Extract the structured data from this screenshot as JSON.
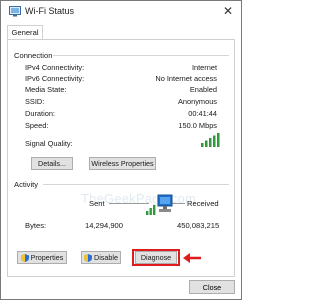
{
  "window": {
    "title": "Wi-Fi Status",
    "close_glyph": "✕"
  },
  "tabs": [
    {
      "label": "General"
    }
  ],
  "connection": {
    "title": "Connection",
    "rows": [
      {
        "label": "IPv4 Connectivity:",
        "value": "Internet"
      },
      {
        "label": "IPv6 Connectivity:",
        "value": "No Internet access"
      },
      {
        "label": "Media State:",
        "value": "Enabled"
      },
      {
        "label": "SSID:",
        "value": "Anonymous"
      },
      {
        "label": "Duration:",
        "value": "00:41:44"
      },
      {
        "label": "Speed:",
        "value": "150.0 Mbps"
      }
    ],
    "signal_label": "Signal Quality:",
    "signal_bars": 5,
    "details_label": "Details...",
    "wireless_label": "Wireless Properties"
  },
  "watermark": "TheGeekPage.com",
  "activity": {
    "title": "Activity",
    "sent_label": "Sent",
    "received_label": "Received",
    "bytes_label": "Bytes:",
    "bytes_sent": "14,294,900",
    "bytes_received": "450,083,215"
  },
  "buttons": {
    "properties": "Properties",
    "disable": "Disable",
    "diagnose": "Diagnose",
    "close": "Close"
  },
  "colors": {
    "signal_green": "#2e9a3c",
    "highlight_red": "#e01b1b"
  },
  "icons": {
    "title": "wifi-status-icon",
    "network": "network-activity-icon",
    "shield": "uac-shield-icon"
  }
}
